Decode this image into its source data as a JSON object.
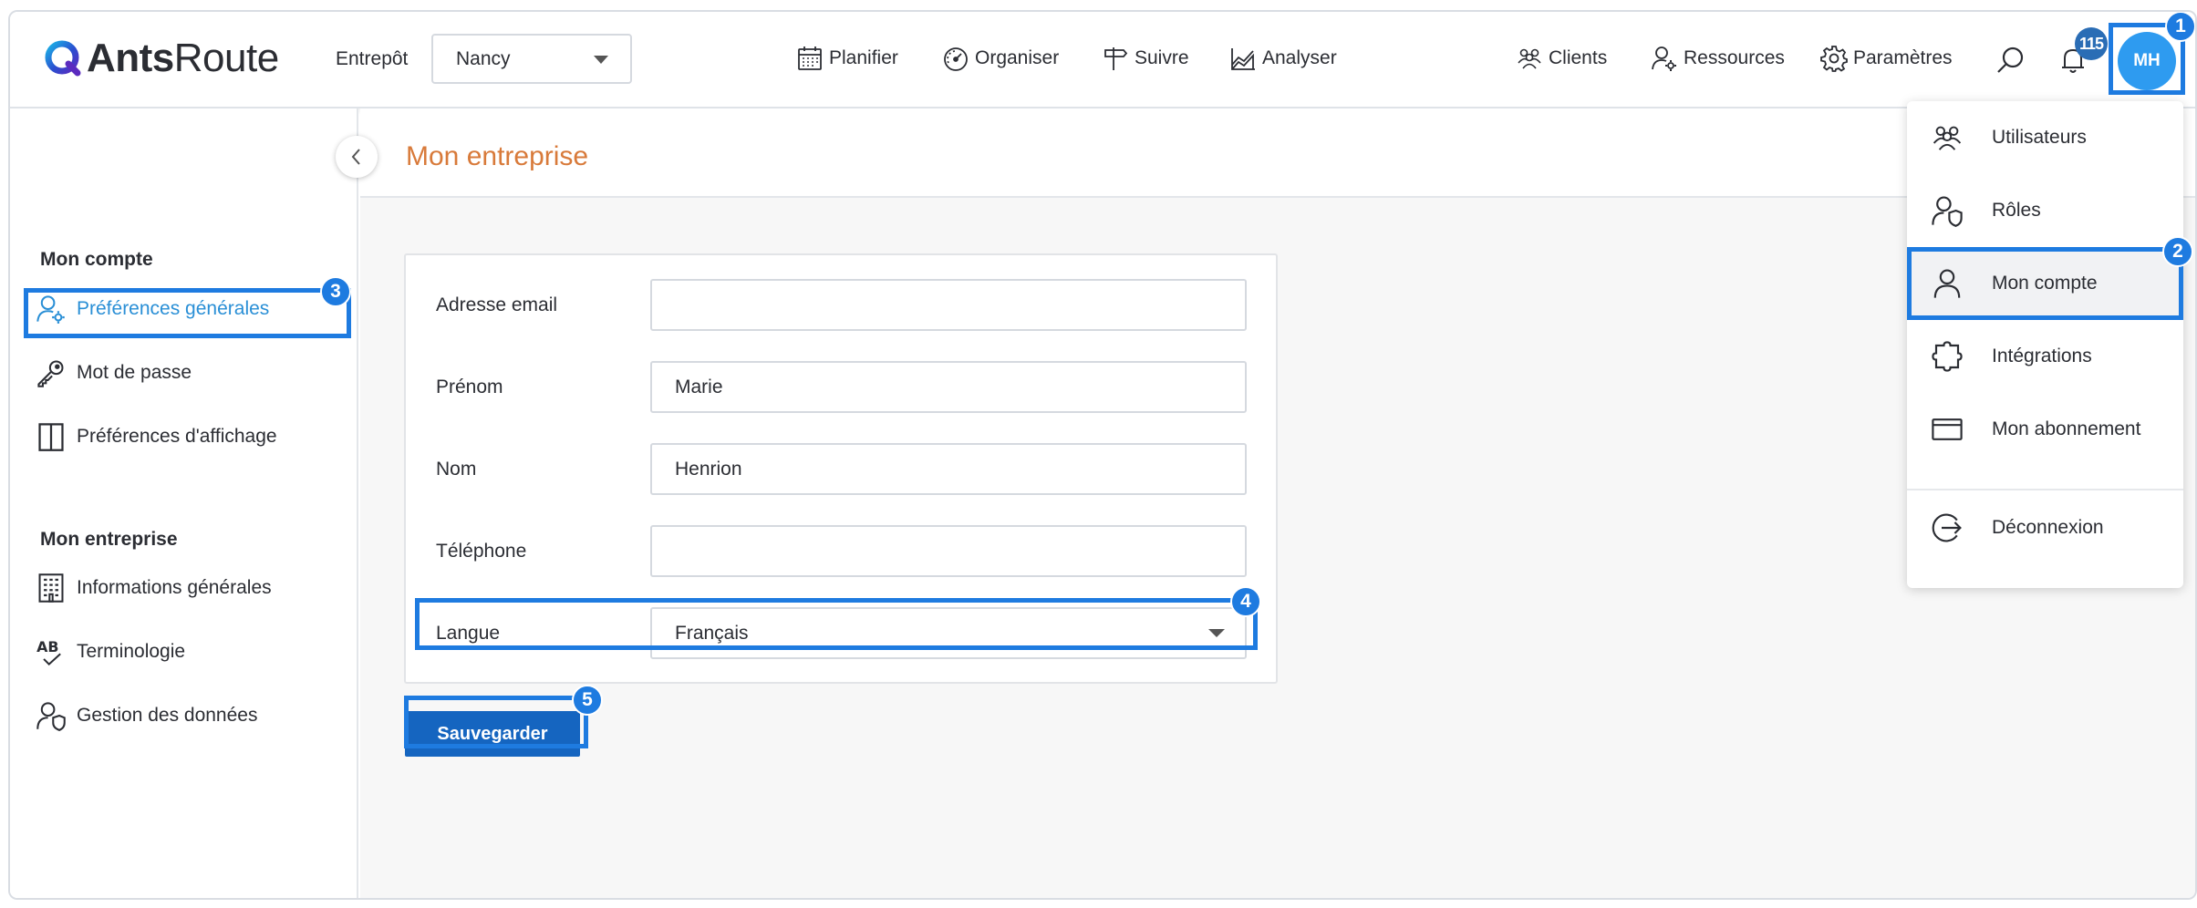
{
  "app": {
    "logo_text_bold": "Ants",
    "logo_text": "Route"
  },
  "header": {
    "warehouse_label": "Entrepôt",
    "warehouse_value": "Nancy",
    "nav": [
      {
        "label": "Planifier",
        "icon": "calendar-icon"
      },
      {
        "label": "Organiser",
        "icon": "gauge-icon"
      },
      {
        "label": "Suivre",
        "icon": "signpost-icon"
      },
      {
        "label": "Analyser",
        "icon": "chart-icon"
      },
      {
        "label": "Clients",
        "icon": "group-icon"
      },
      {
        "label": "Ressources",
        "icon": "user-gear-icon"
      },
      {
        "label": "Paramètres",
        "icon": "gear-icon"
      }
    ],
    "notification_count": "115",
    "avatar_initials": "MH"
  },
  "steps": [
    "1",
    "2",
    "3",
    "4",
    "5"
  ],
  "sidebar": {
    "section_account": "Mon compte",
    "account_items": [
      {
        "label": "Préférences générales",
        "icon": "user-gear-icon",
        "active": true
      },
      {
        "label": "Mot de passe",
        "icon": "key-icon"
      },
      {
        "label": "Préférences d'affichage",
        "icon": "columns-icon"
      }
    ],
    "section_company": "Mon entreprise",
    "company_items": [
      {
        "label": "Informations générales",
        "icon": "building-icon"
      },
      {
        "label": "Terminologie",
        "icon": "ab-check-icon"
      },
      {
        "label": "Gestion des données",
        "icon": "user-shield-icon"
      }
    ]
  },
  "main": {
    "page_title": "Mon entreprise",
    "form": {
      "email_label": "Adresse email",
      "email_value": "",
      "firstname_label": "Prénom",
      "firstname_value": "Marie",
      "lastname_label": "Nom",
      "lastname_value": "Henrion",
      "phone_label": "Téléphone",
      "phone_value": "",
      "language_label": "Langue",
      "language_value": "Français"
    },
    "save_label": "Sauvegarder"
  },
  "menu": {
    "items": [
      {
        "label": "Utilisateurs",
        "icon": "users-icon"
      },
      {
        "label": "Rôles",
        "icon": "user-shield-icon"
      },
      {
        "label": "Mon compte",
        "icon": "user-icon"
      },
      {
        "label": "Intégrations",
        "icon": "puzzle-icon"
      },
      {
        "label": "Mon abonnement",
        "icon": "credit-card-icon"
      }
    ],
    "logout_label": "Déconnexion"
  },
  "colors": {
    "accent": "#1e7be0",
    "title_orange": "#d87a3a",
    "button_blue": "#1565c0",
    "active_blue": "#2a8fd6"
  }
}
